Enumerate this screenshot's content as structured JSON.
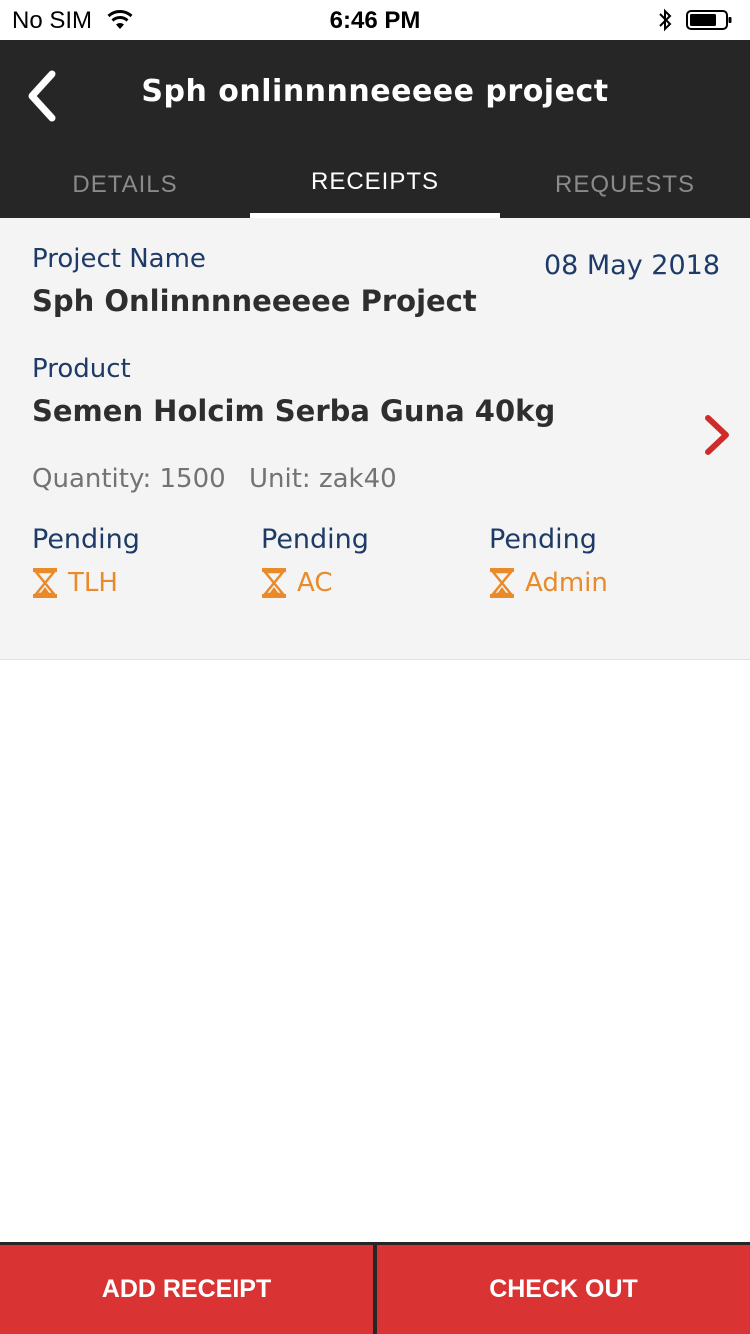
{
  "status_bar": {
    "carrier": "No SIM",
    "time": "6:46 PM"
  },
  "header": {
    "title": "Sph onlinnnneeeee project"
  },
  "tabs": [
    {
      "label": "DETAILS",
      "active": false
    },
    {
      "label": "RECEIPTS",
      "active": true
    },
    {
      "label": "REQUESTS",
      "active": false
    }
  ],
  "receipt": {
    "project_name_label": "Project Name",
    "project_name": "Sph Onlinnnneeeee Project",
    "date": "08 May 2018",
    "product_label": "Product",
    "product": "Semen Holcim Serba Guna 40kg",
    "quantity_text": "Quantity: 1500",
    "unit_text": "Unit: zak40",
    "statuses": [
      {
        "state": "Pending",
        "role": "TLH"
      },
      {
        "state": "Pending",
        "role": "AC"
      },
      {
        "state": "Pending",
        "role": "Admin"
      }
    ]
  },
  "actions": {
    "add_receipt": "ADD RECEIPT",
    "check_out": "CHECK OUT"
  },
  "colors": {
    "header_bg": "#262626",
    "label_blue": "#1d3b66",
    "pending_orange": "#e98a2b",
    "action_red": "#d93333",
    "chevron_red": "#d12a2a",
    "card_bg": "#f4f4f4"
  },
  "icons": {
    "back": "chevron-left-icon",
    "open_detail": "chevron-right-icon",
    "pending": "hourglass-icon"
  }
}
